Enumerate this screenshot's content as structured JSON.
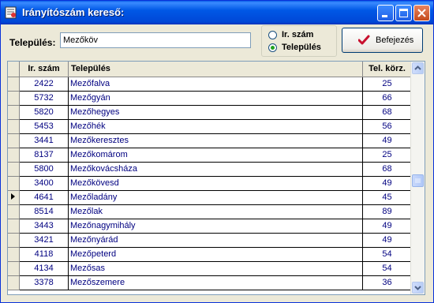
{
  "window": {
    "title": "Irányítószám kereső:"
  },
  "search": {
    "label": "Település:",
    "value": "Mezőköv"
  },
  "mode": {
    "options": [
      {
        "label": "Ir. szám",
        "checked": false
      },
      {
        "label": "Település",
        "checked": true
      }
    ]
  },
  "exit": {
    "label": "Befejezés"
  },
  "grid": {
    "columns": [
      "Ir. szám",
      "Település",
      "Tel. körz."
    ],
    "current_row_index": 8,
    "rows": [
      {
        "code": "2422",
        "name": "Mezőfalva",
        "area": "25"
      },
      {
        "code": "5732",
        "name": "Mezőgyán",
        "area": "66"
      },
      {
        "code": "5820",
        "name": "Mezőhegyes",
        "area": "68"
      },
      {
        "code": "5453",
        "name": "Mezőhék",
        "area": "56"
      },
      {
        "code": "3441",
        "name": "Mezőkeresztes",
        "area": "49"
      },
      {
        "code": "8137",
        "name": "Mezőkomárom",
        "area": "25"
      },
      {
        "code": "5800",
        "name": "Mezőkovácsháza",
        "area": "68"
      },
      {
        "code": "3400",
        "name": "Mezőkövesd",
        "area": "49"
      },
      {
        "code": "4641",
        "name": "Mezőladány",
        "area": "45"
      },
      {
        "code": "8514",
        "name": "Mezőlak",
        "area": "89"
      },
      {
        "code": "3443",
        "name": "Mezőnagymihály",
        "area": "49"
      },
      {
        "code": "3421",
        "name": "Mezőnyárád",
        "area": "49"
      },
      {
        "code": "4118",
        "name": "Mezőpeterd",
        "area": "54"
      },
      {
        "code": "4134",
        "name": "Mezősas",
        "area": "54"
      },
      {
        "code": "3378",
        "name": "Mezőszemere",
        "area": "36"
      }
    ]
  },
  "colors": {
    "title_bar": "#0054e3",
    "link_text": "#000080",
    "radio_dot": "#21a121",
    "exit_check": "#c8102e"
  },
  "icons": [
    "app-icon",
    "minimize-icon",
    "maximize-icon",
    "close-icon",
    "checkmark-icon",
    "current-row-arrow-icon",
    "scroll-up-icon",
    "scroll-down-icon"
  ]
}
